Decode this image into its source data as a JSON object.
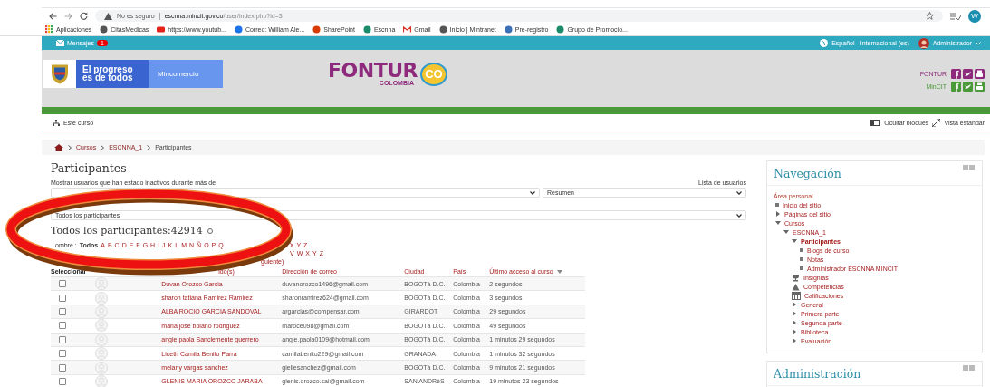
{
  "browser": {
    "security": "No es seguro",
    "url_host": "escnna.mincit.gov.co",
    "url_path": "/user/index.php?id=3",
    "profile": "W",
    "bookmarks": [
      {
        "label": "Aplicaciones",
        "kind": "apps"
      },
      {
        "label": "CitasMedicas",
        "kind": "globe"
      },
      {
        "label": "https://www.youtub...",
        "kind": "video"
      },
      {
        "label": "Correo: William Ale...",
        "kind": "mail"
      },
      {
        "label": "SharePoint",
        "kind": "office"
      },
      {
        "label": "Escnna",
        "kind": "site"
      },
      {
        "label": "Gmail",
        "kind": "gmail"
      },
      {
        "label": "Inicio | Mintranet",
        "kind": "globe"
      },
      {
        "label": "Pre-registro",
        "kind": "image"
      },
      {
        "label": "Grupo de Promocio...",
        "kind": "site"
      }
    ]
  },
  "top_bar": {
    "messages": "Mensajes",
    "messages_count": "1",
    "language": "Español - Internacional (es)",
    "user": "Administrador"
  },
  "header": {
    "tagline_1": "El progreso",
    "tagline_2": "es de todos",
    "ministry": "Mincomercio",
    "logo": "FONTUR",
    "logo_sub": "COLOMBIA",
    "logo_badge": "CO",
    "social": [
      {
        "label": "FONTUR"
      },
      {
        "label": "MinCIT"
      }
    ]
  },
  "course_bar": {
    "course": "Este curso",
    "hide_blocks": "Ocultar bloques",
    "standard_view": "Vista estándar"
  },
  "breadcrumb": [
    "Cursos",
    "ESCNNA_1",
    "Participantes"
  ],
  "page": {
    "title": "Participantes",
    "inactive_label": "Mostrar usuarios que han estado inactivos durante más de",
    "user_list_label": "Lista de usuarios",
    "view_select": "Resumen",
    "role_select": "Todos los participantes",
    "count_title": "Todos los participantes:42914",
    "filters": [
      {
        "label": "ombre :",
        "all": "Todos",
        "segments": [
          [
            "A",
            "B",
            "C",
            "D",
            "E",
            "F",
            "G",
            "H",
            "I",
            "J",
            "K",
            "L",
            "M",
            "N",
            "Ñ",
            "O",
            "P",
            "Q"
          ],
          [
            "X",
            "Y",
            "Z"
          ]
        ]
      },
      {
        "segments": [
          [
            "V",
            "W",
            "X",
            "Y",
            "Z"
          ]
        ]
      }
    ],
    "paging": "guiente)"
  },
  "table": {
    "columns": [
      "Seleccionar",
      "ido(s)",
      "Dirección de correo",
      "Ciudad",
      "País",
      "Último acceso al curso"
    ],
    "rows": [
      {
        "checked": false,
        "name": "Duvan Orozco Garcia",
        "email": "duvanorozco1496@gmail.com",
        "city": "BOGOTá D.C.",
        "country": "Colombia",
        "last_access": "2 segundos"
      },
      {
        "checked": false,
        "name": "sharon tatiana Ramirez Ramirez",
        "email": "sharonramirez624@gmail.com",
        "city": "BOGOTá D.C.",
        "country": "Colombia",
        "last_access": "3 segundos"
      },
      {
        "checked": false,
        "name": "ALBA ROCIO GARCIA SANDOVAL",
        "email": "argarcias@compensar.com",
        "city": "GIRARDOT",
        "country": "Colombia",
        "last_access": "29 segundos"
      },
      {
        "checked": false,
        "name": "maria jose bolaño rodriguez",
        "email": "maroce098@gmail.com",
        "city": "BOGOTá D.C.",
        "country": "Colombia",
        "last_access": "49 segundos"
      },
      {
        "checked": false,
        "name": "angie paola Sanclemente guerrero",
        "email": "angie.paola0109@hotmail.com",
        "city": "BOGOTá D.C.",
        "country": "Colombia",
        "last_access": "1 minutos 29 segundos"
      },
      {
        "checked": false,
        "name": "Liceth Camila Benito Parra",
        "email": "camilabenito229@gmail.com",
        "city": "GRANADA",
        "country": "Colombia",
        "last_access": "1 minutos 32 segundos"
      },
      {
        "checked": false,
        "name": "melany vargas sanchez",
        "email": "giellesanchez@gmail.com",
        "city": "BOGOTá D.C.",
        "country": "Colombia",
        "last_access": "9 minutos 21 segundos"
      },
      {
        "checked": false,
        "name": "GLENIS MARIA OROZCO JARABA",
        "email": "glenis.orozco.sai@gmail.com",
        "city": "SAN ANDRéS",
        "country": "Colombia",
        "last_access": "19 minutos 23 segundos"
      }
    ]
  },
  "navigation": {
    "title": "Navegación",
    "tree": [
      {
        "label": "Área personal",
        "kind": "plain",
        "current": false,
        "children": [
          {
            "label": "Inicio del sitio",
            "kind": "leaf",
            "current": false
          },
          {
            "label": "Páginas del sitio",
            "kind": "branch",
            "expanded": false,
            "current": false
          },
          {
            "label": "Cursos",
            "kind": "branch",
            "expanded": true,
            "current": false,
            "children": [
              {
                "label": "ESCNNA_1",
                "kind": "branch",
                "expanded": true,
                "current": false,
                "children": [
                  {
                    "label": "Participantes",
                    "kind": "branch",
                    "expanded": true,
                    "current": true,
                    "children": [
                      {
                        "label": "Blogs de curso",
                        "kind": "leaf",
                        "current": false
                      },
                      {
                        "label": "Notas",
                        "kind": "leaf",
                        "current": false
                      },
                      {
                        "label": "Administrador ESCNNA MINCIT",
                        "kind": "leaf",
                        "current": false
                      }
                    ]
                  },
                  {
                    "label": "Insignias",
                    "kind": "trophy",
                    "current": false
                  },
                  {
                    "label": "Competencias",
                    "kind": "competency",
                    "current": false
                  },
                  {
                    "label": "Calificaciones",
                    "kind": "grades",
                    "current": false
                  },
                  {
                    "label": "General",
                    "kind": "branch",
                    "expanded": false,
                    "current": false
                  },
                  {
                    "label": "Primera parte",
                    "kind": "branch",
                    "expanded": false,
                    "current": false
                  },
                  {
                    "label": "Segunda parte",
                    "kind": "branch",
                    "expanded": false,
                    "current": false
                  },
                  {
                    "label": "Biblioteca",
                    "kind": "branch",
                    "expanded": false,
                    "current": false
                  },
                  {
                    "label": "Evaluación",
                    "kind": "branch",
                    "expanded": false,
                    "current": false
                  }
                ]
              }
            ]
          }
        ]
      }
    ]
  },
  "administration": {
    "title": "Administración"
  }
}
